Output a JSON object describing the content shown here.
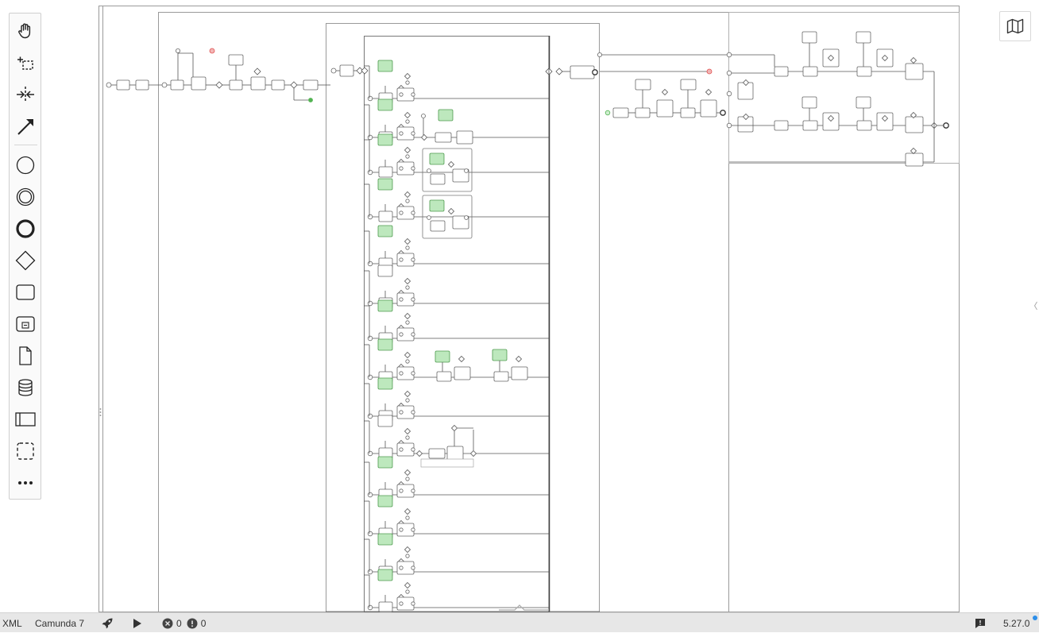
{
  "palette": {
    "tools": [
      {
        "name": "hand-tool",
        "label": "Activate hand tool"
      },
      {
        "name": "lasso-tool",
        "label": "Activate lasso tool"
      },
      {
        "name": "space-tool",
        "label": "Activate create/remove space tool"
      },
      {
        "name": "global-connect-tool",
        "label": "Activate global connect tool"
      },
      {
        "name": "start-event",
        "label": "Create start event"
      },
      {
        "name": "intermediate-event",
        "label": "Create intermediate/boundary event"
      },
      {
        "name": "end-event",
        "label": "Create end event"
      },
      {
        "name": "gateway",
        "label": "Create gateway"
      },
      {
        "name": "task",
        "label": "Create task"
      },
      {
        "name": "subprocess",
        "label": "Create expanded sub-process"
      },
      {
        "name": "data-object",
        "label": "Create data object reference"
      },
      {
        "name": "data-store",
        "label": "Create data store reference"
      },
      {
        "name": "pool",
        "label": "Create pool/participant"
      },
      {
        "name": "group",
        "label": "Create group"
      },
      {
        "name": "more",
        "label": "Create element"
      }
    ]
  },
  "colors": {
    "ui_border": "#cfcfcf",
    "diagram_line": "#444444",
    "green_task_fill": "#bde8bd",
    "green_task_stroke": "#4f9b4f",
    "error_event": "#e05050",
    "start_event_green": "#52b352",
    "statusbar_bg": "#e7e7e7",
    "notification_dot": "#2d8fe9"
  },
  "statusbar": {
    "xml_label": "XML",
    "platform_label": "Camunda 7",
    "deploy_icon": "rocket-icon",
    "run_icon": "play-icon",
    "error_count": "0",
    "warning_count": "0",
    "feedback_icon": "feedback-icon",
    "version": "5.27.0"
  },
  "minimap": {
    "icon": "map-icon"
  }
}
